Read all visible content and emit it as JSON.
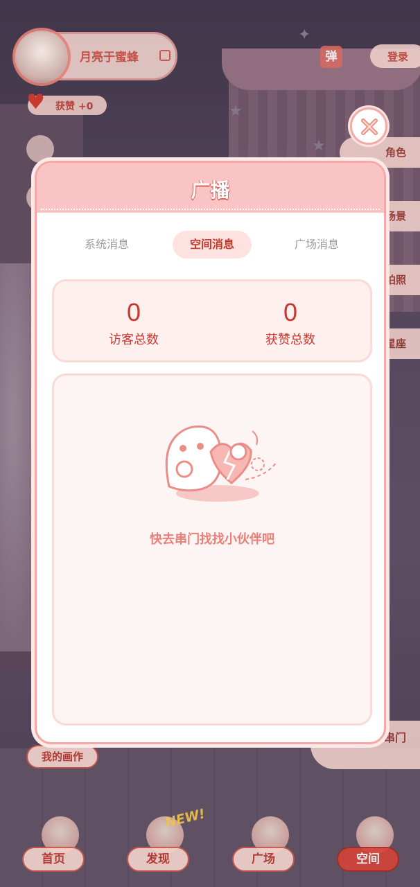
{
  "profile": {
    "username": "月亮于蜜蜂",
    "likes_label": "获赞 +0"
  },
  "topbar": {
    "danmu_label": "弹",
    "login_label": "登录"
  },
  "side_menu": {
    "items": [
      "角色",
      "场景",
      "拍照",
      "星座",
      "串门"
    ]
  },
  "left_menu": {
    "my_painting_label": "我的画作"
  },
  "bottom_nav": {
    "items": [
      {
        "label": "首页"
      },
      {
        "label": "发现"
      },
      {
        "label": "广场"
      },
      {
        "label": "空间"
      }
    ],
    "active": "空间",
    "new_badge": "NEW!"
  },
  "modal": {
    "title": "广播",
    "tabs": [
      "系统消息",
      "空间消息",
      "广场消息"
    ],
    "active_tab": "空间消息",
    "stats": [
      {
        "value": "0",
        "label": "访客总数"
      },
      {
        "value": "0",
        "label": "获赞总数"
      }
    ],
    "empty_message": "快去串门找找小伙伴吧"
  },
  "colors": {
    "accent": "#c8382e",
    "modal_header": "#f9c4c3",
    "modal_border": "#f4a9a6"
  }
}
